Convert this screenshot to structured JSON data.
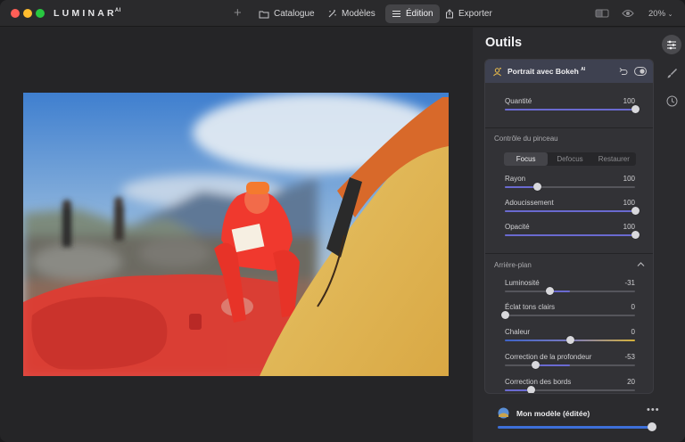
{
  "app": {
    "logo": "LUMINAR",
    "logo_sup": "AI",
    "colors": {
      "accent": "#6a6ad0",
      "brand_blue": "#3d6fd8"
    }
  },
  "nav": {
    "catalogue": "Catalogue",
    "modeles": "Modèles",
    "edition": "Édition",
    "exporter": "Exporter",
    "zoom": "20%"
  },
  "panel": {
    "title": "Outils",
    "tool": {
      "name": "Portrait avec Bokeh",
      "name_sup": "AI",
      "quantity": {
        "label": "Quantité",
        "value": "100",
        "level": 1.0
      },
      "brush_section": "Contrôle du pinceau",
      "brush_modes": [
        "Focus",
        "Defocus",
        "Restaurer"
      ],
      "brush_active": "Focus",
      "rayon": {
        "label": "Rayon",
        "value": "100",
        "level": 0.25
      },
      "adoucissement": {
        "label": "Adoucissement",
        "value": "100",
        "level": 1.0
      },
      "opacite": {
        "label": "Opacité",
        "value": "100",
        "level": 1.0
      },
      "background_section": "Arrière-plan",
      "luminosite": {
        "label": "Luminosité",
        "value": "-31",
        "level": -0.31
      },
      "eclat": {
        "label": "Éclat tons clairs",
        "value": "0",
        "level": 0
      },
      "chaleur": {
        "label": "Chaleur",
        "value": "0",
        "level": 0
      },
      "profondeur": {
        "label": "Correction de la profondeur",
        "value": "-53",
        "level": -0.53
      },
      "bords": {
        "label": "Correction des bords",
        "value": "20",
        "level": 0.2
      }
    }
  },
  "footer": {
    "preset": "Mon modèle (éditée)",
    "preset_level": 1.0
  }
}
